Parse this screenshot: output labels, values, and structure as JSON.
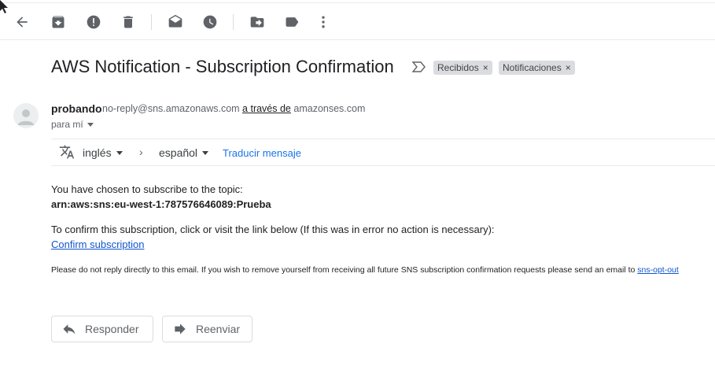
{
  "toolbar": {
    "items": [
      "back-icon",
      "archive-icon",
      "report-spam-icon",
      "delete-icon",
      "mark-unread-icon",
      "snooze-icon",
      "move-to-icon",
      "labels-icon",
      "more-icon"
    ]
  },
  "email": {
    "subject": "AWS Notification - Subscription Confirmation",
    "labels": [
      "Recibidos",
      "Notificaciones"
    ],
    "label_remove": "×",
    "sender_name": "probando",
    "sender_email": "no-reply@sns.amazonaws.com",
    "via_text": "a través de",
    "via_domain": "amazonses.com",
    "to_text": "para mí"
  },
  "translate": {
    "from": "inglés",
    "arrow": "›",
    "to": "español",
    "link": "Traducir mensaje"
  },
  "body": {
    "line1": "You have chosen to subscribe to the topic:",
    "topic_arn": "arn:aws:sns:eu-west-1:787576646089:Prueba",
    "line2": "To confirm this subscription, click or visit the link below (If this was in error no action is necessary):",
    "confirm_link": "Confirm subscription",
    "footer_text": "Please do not reply directly to this email. If you wish to remove yourself from receiving all future SNS subscription confirmation requests please send an email to",
    "opt_out_link": "sns-opt-out"
  },
  "actions": {
    "reply": "Responder",
    "forward": "Reenviar"
  },
  "colors": {
    "link": "#1155cc",
    "translate_link": "#1a73e8",
    "label_chip": "#dadce0",
    "icon": "#5f6368"
  }
}
